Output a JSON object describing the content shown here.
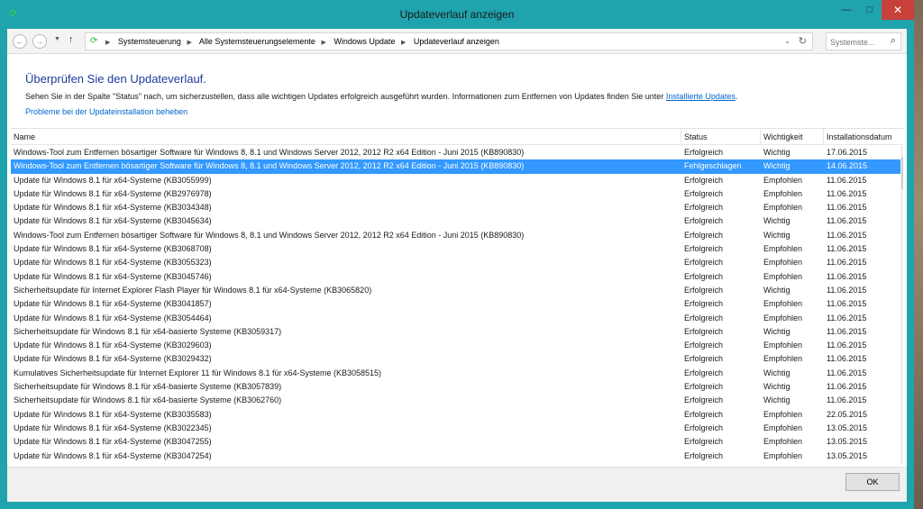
{
  "window": {
    "title": "Updateverlauf anzeigen",
    "minimize": "—",
    "maximize": "□",
    "close": "✕"
  },
  "addressbar": {
    "back": "←",
    "forward": "→",
    "up": "↑",
    "breadcrumbs": [
      "Systemsteuerung",
      "Alle Systemsteuerungselemente",
      "Windows Update",
      "Updateverlauf anzeigen"
    ],
    "search_placeholder": "Systemste...",
    "refresh": "↻"
  },
  "content": {
    "heading": "Überprüfen Sie den Updateverlauf.",
    "description": "Sehen Sie in der Spalte \"Status\" nach, um sicherzustellen, dass alle wichtigen Updates erfolgreich ausgeführt wurden. Informationen zum Entfernen von Updates finden Sie unter ",
    "installed_updates_link": "Installierte Updates",
    "description_end": ".",
    "problems_link": "Probleme bei der Updateinstallation beheben"
  },
  "table": {
    "columns": {
      "name": "Name",
      "status": "Status",
      "importance": "Wichtigkeit",
      "date": "Installationsdatum"
    },
    "selected_index": 1,
    "rows": [
      {
        "name": "Windows-Tool zum Entfernen bösartiger Software für Windows 8, 8.1 und Windows Server 2012, 2012 R2 x64 Edition - Juni 2015 (KB890830)",
        "status": "Erfolgreich",
        "importance": "Wichtig",
        "date": "17.06.2015"
      },
      {
        "name": "Windows-Tool zum Entfernen bösartiger Software für Windows 8, 8.1 und Windows Server 2012, 2012 R2 x64 Edition - Juni 2015 (KB890830)",
        "status": "Fehlgeschlagen",
        "importance": "Wichtig",
        "date": "14.06.2015"
      },
      {
        "name": "Update für Windows 8.1 für x64-Systeme (KB3055999)",
        "status": "Erfolgreich",
        "importance": "Empfohlen",
        "date": "11.06.2015"
      },
      {
        "name": "Update für Windows 8.1 für x64-Systeme (KB2976978)",
        "status": "Erfolgreich",
        "importance": "Empfohlen",
        "date": "11.06.2015"
      },
      {
        "name": "Update für Windows 8.1 für x64-Systeme (KB3034348)",
        "status": "Erfolgreich",
        "importance": "Empfohlen",
        "date": "11.06.2015"
      },
      {
        "name": "Update für Windows 8.1 für x64-Systeme (KB3045634)",
        "status": "Erfolgreich",
        "importance": "Wichtig",
        "date": "11.06.2015"
      },
      {
        "name": "Windows-Tool zum Entfernen bösartiger Software für Windows 8, 8.1 und Windows Server 2012, 2012 R2 x64 Edition - Juni 2015 (KB890830)",
        "status": "Erfolgreich",
        "importance": "Wichtig",
        "date": "11.06.2015"
      },
      {
        "name": "Update für Windows 8.1 für x64-Systeme (KB3068708)",
        "status": "Erfolgreich",
        "importance": "Empfohlen",
        "date": "11.06.2015"
      },
      {
        "name": "Update für Windows 8.1 für x64-Systeme (KB3055323)",
        "status": "Erfolgreich",
        "importance": "Empfohlen",
        "date": "11.06.2015"
      },
      {
        "name": "Update für Windows 8.1 für x64-Systeme (KB3045746)",
        "status": "Erfolgreich",
        "importance": "Empfohlen",
        "date": "11.06.2015"
      },
      {
        "name": "Sicherheitsupdate für Internet Explorer Flash Player für Windows 8.1 für x64-Systeme (KB3065820)",
        "status": "Erfolgreich",
        "importance": "Wichtig",
        "date": "11.06.2015"
      },
      {
        "name": "Update für Windows 8.1 für x64-Systeme (KB3041857)",
        "status": "Erfolgreich",
        "importance": "Empfohlen",
        "date": "11.06.2015"
      },
      {
        "name": "Update für Windows 8.1 für x64-Systeme (KB3054464)",
        "status": "Erfolgreich",
        "importance": "Empfohlen",
        "date": "11.06.2015"
      },
      {
        "name": "Sicherheitsupdate für Windows 8.1 für x64-basierte Systeme (KB3059317)",
        "status": "Erfolgreich",
        "importance": "Wichtig",
        "date": "11.06.2015"
      },
      {
        "name": "Update für Windows 8.1 für x64-Systeme (KB3029603)",
        "status": "Erfolgreich",
        "importance": "Empfohlen",
        "date": "11.06.2015"
      },
      {
        "name": "Update für Windows 8.1 für x64-Systeme (KB3029432)",
        "status": "Erfolgreich",
        "importance": "Empfohlen",
        "date": "11.06.2015"
      },
      {
        "name": "Kumulatives Sicherheitsupdate für Internet Explorer 11 für Windows 8.1 für x64-Systeme (KB3058515)",
        "status": "Erfolgreich",
        "importance": "Wichtig",
        "date": "11.06.2015"
      },
      {
        "name": "Sicherheitsupdate für Windows 8.1 für x64-basierte Systeme (KB3057839)",
        "status": "Erfolgreich",
        "importance": "Wichtig",
        "date": "11.06.2015"
      },
      {
        "name": "Sicherheitsupdate für Windows 8.1 für x64-basierte Systeme (KB3062760)",
        "status": "Erfolgreich",
        "importance": "Wichtig",
        "date": "11.06.2015"
      },
      {
        "name": "Update für Windows 8.1 für x64-Systeme (KB3035583)",
        "status": "Erfolgreich",
        "importance": "Empfohlen",
        "date": "22.05.2015"
      },
      {
        "name": "Update für Windows 8.1 für x64-Systeme (KB3022345)",
        "status": "Erfolgreich",
        "importance": "Empfohlen",
        "date": "13.05.2015"
      },
      {
        "name": "Update für Windows 8.1 für x64-Systeme (KB3047255)",
        "status": "Erfolgreich",
        "importance": "Empfohlen",
        "date": "13.05.2015"
      },
      {
        "name": "Update für Windows 8.1 für x64-Systeme (KB3047254)",
        "status": "Erfolgreich",
        "importance": "Empfohlen",
        "date": "13.05.2015"
      }
    ]
  },
  "footer": {
    "ok_label": "OK"
  },
  "colors": {
    "titlebar": "#1fa3ac",
    "selection": "#3399ff",
    "heading": "#1e3c99",
    "link": "#0066cc",
    "close": "#c7413a"
  }
}
